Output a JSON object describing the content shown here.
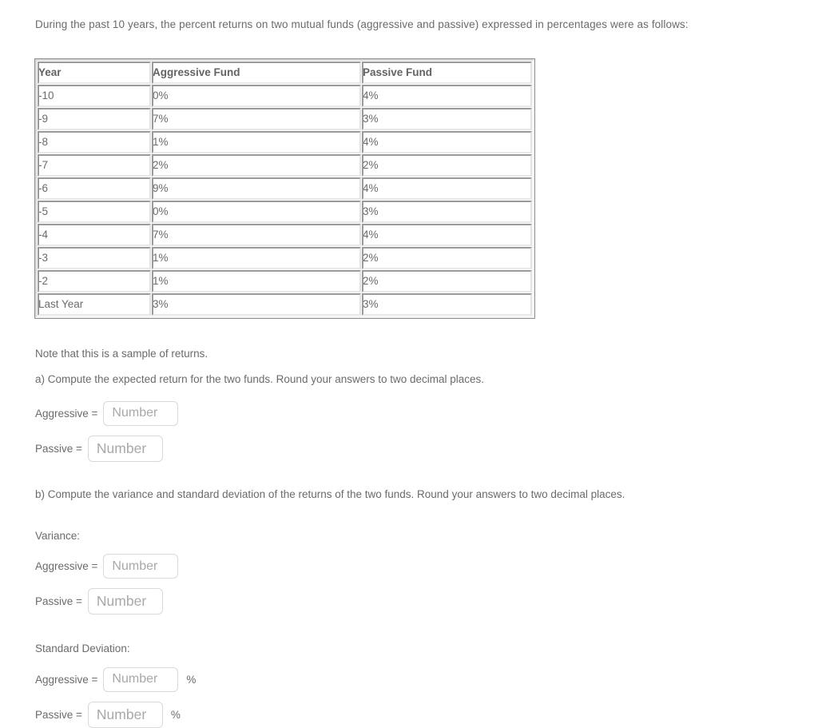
{
  "intro": "During the past 10 years, the percent returns on two mutual funds (aggressive and passive) expressed in percentages were as follows:",
  "table": {
    "headers": [
      "Year",
      "Aggressive Fund",
      "Passive Fund"
    ],
    "rows": [
      [
        "-10",
        "0%",
        "4%"
      ],
      [
        "-9",
        "7%",
        "3%"
      ],
      [
        "-8",
        "1%",
        "4%"
      ],
      [
        "-7",
        "2%",
        "2%"
      ],
      [
        "-6",
        "9%",
        "4%"
      ],
      [
        "-5",
        "0%",
        "3%"
      ],
      [
        "-4",
        "7%",
        "4%"
      ],
      [
        "-3",
        "1%",
        "2%"
      ],
      [
        "-2",
        "1%",
        "2%"
      ],
      [
        "Last Year",
        "3%",
        "3%"
      ]
    ]
  },
  "note": "Note that this is a sample of returns.",
  "question_a": "a) Compute the expected return for the two funds.  Round your answers to two decimal places.",
  "question_b": "b) Compute the variance and standard deviation of the returns of the two funds.  Round your answers to two decimal places.",
  "labels": {
    "aggressive": "Aggressive =",
    "passive": "Passive =",
    "variance": "Variance:",
    "standard_deviation": "Standard Deviation:",
    "percent_suffix": "%"
  },
  "inputs": {
    "placeholder": "Number",
    "expected_return_aggressive": "",
    "expected_return_passive": "",
    "variance_aggressive": "",
    "variance_passive": "",
    "stdev_aggressive": "",
    "stdev_passive": ""
  },
  "colors": {
    "text": "#6b6b6b",
    "placeholder": "#a8a8a8",
    "input_border": "#d9d9d9",
    "table_cell_border": "#9a9a9a",
    "background": "#ffffff"
  }
}
